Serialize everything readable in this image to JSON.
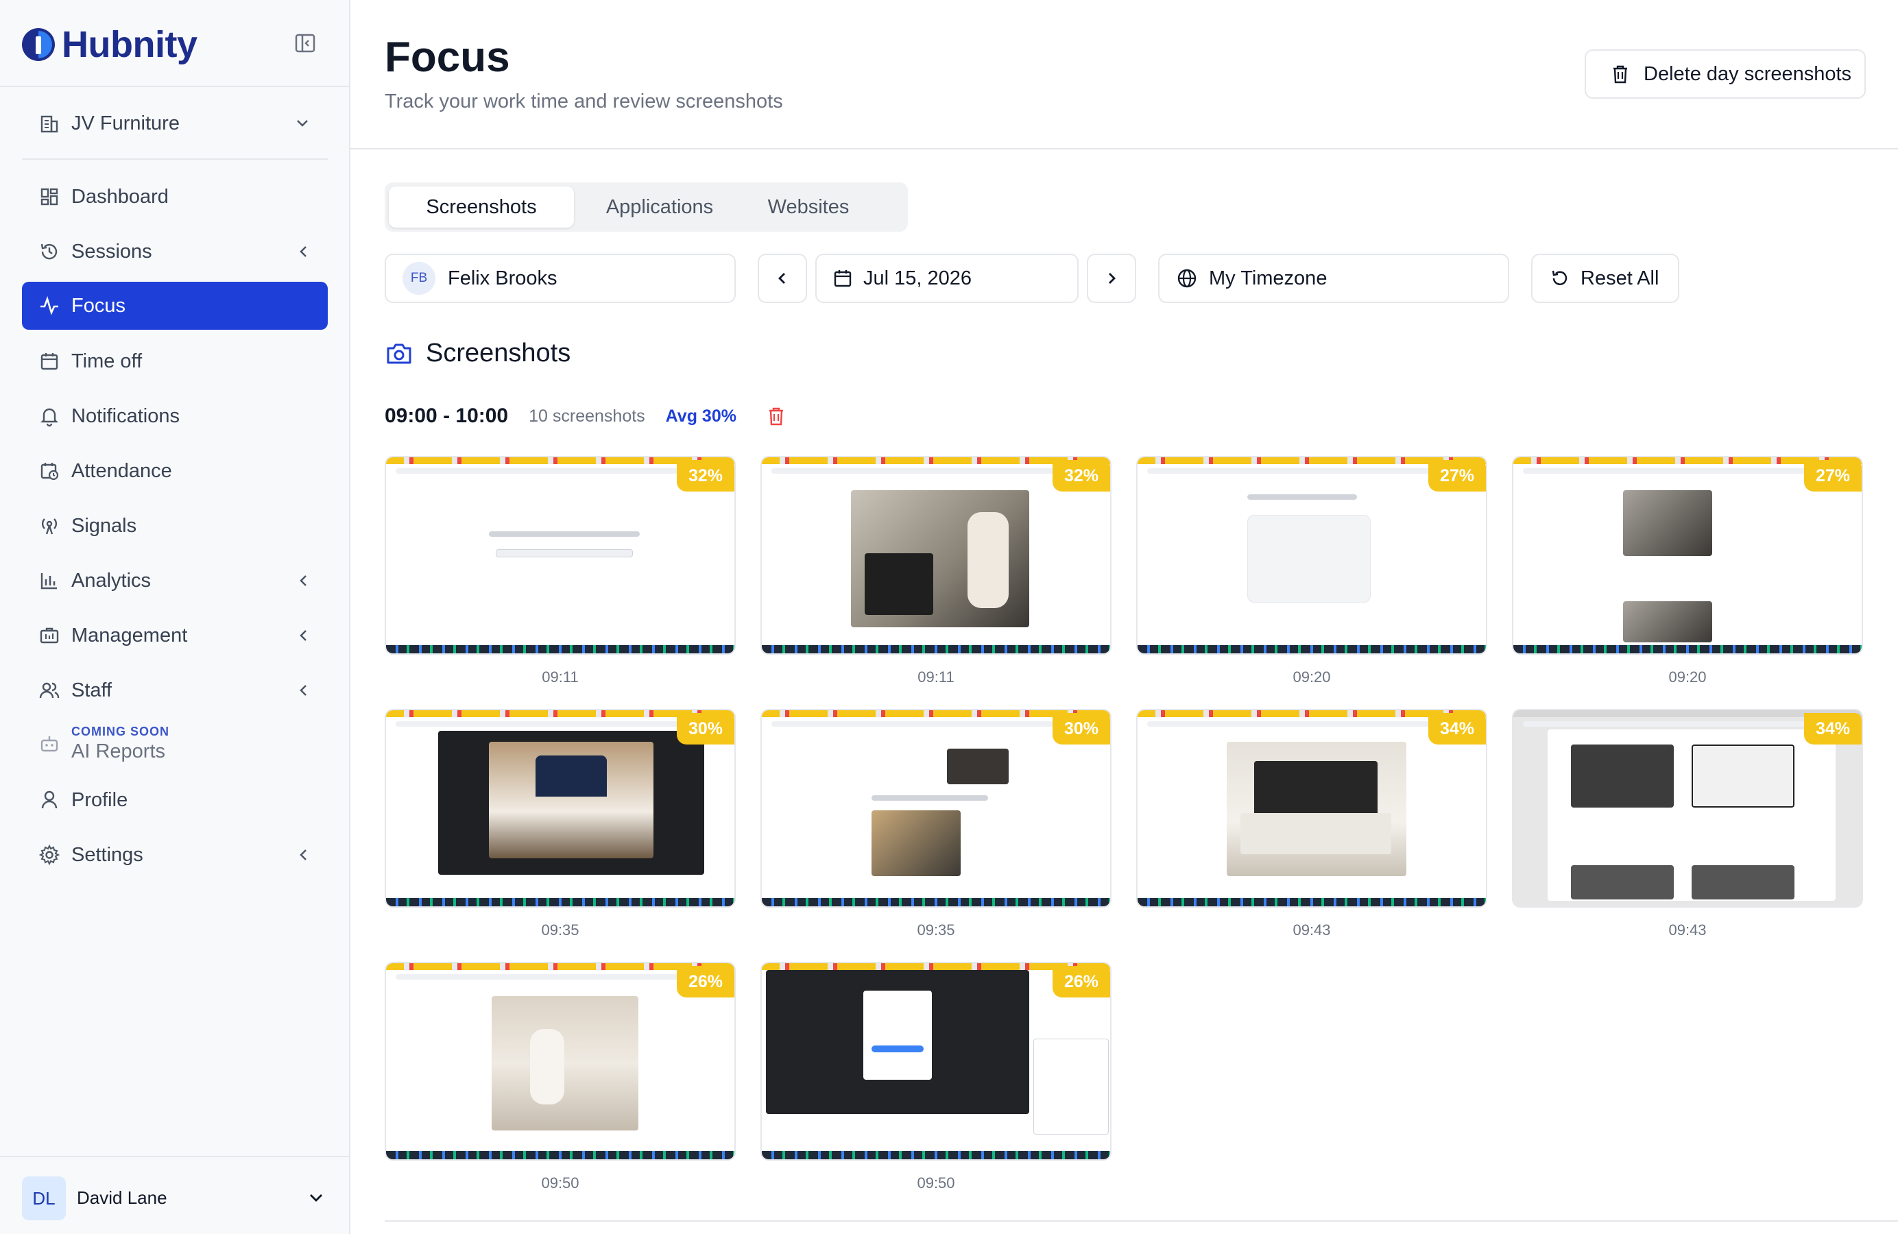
{
  "brand": {
    "name": "Hubnity",
    "primary": "#1f40d8",
    "accent_yellow": "#f5c518",
    "danger": "#ef4444"
  },
  "sidebar": {
    "company": "JV Furniture",
    "items": [
      {
        "label": "Dashboard",
        "icon": "dashboard-icon",
        "expandable": false,
        "active": false
      },
      {
        "label": "Sessions",
        "icon": "history-icon",
        "expandable": true,
        "active": false
      },
      {
        "label": "Focus",
        "icon": "activity-icon",
        "expandable": false,
        "active": true
      },
      {
        "label": "Time off",
        "icon": "calendar-icon",
        "expandable": false,
        "active": false
      },
      {
        "label": "Notifications",
        "icon": "bell-icon",
        "expandable": false,
        "active": false
      },
      {
        "label": "Attendance",
        "icon": "calendar-clock-icon",
        "expandable": false,
        "active": false
      },
      {
        "label": "Signals",
        "icon": "signal-icon",
        "expandable": false,
        "active": false
      },
      {
        "label": "Analytics",
        "icon": "bar-chart-icon",
        "expandable": true,
        "active": false
      },
      {
        "label": "Management",
        "icon": "briefcase-icon",
        "expandable": true,
        "active": false
      },
      {
        "label": "Staff",
        "icon": "users-icon",
        "expandable": true,
        "active": false
      }
    ],
    "coming_soon": {
      "tag": "COMING SOON",
      "label": "AI Reports"
    },
    "bottom_items": [
      {
        "label": "Profile",
        "icon": "user-icon",
        "expandable": false
      },
      {
        "label": "Settings",
        "icon": "gear-icon",
        "expandable": true
      }
    ],
    "user": {
      "initials": "DL",
      "name": "David Lane"
    }
  },
  "header": {
    "title": "Focus",
    "subtitle": "Track your work time and review screenshots",
    "delete_day_label": "Delete day screenshots"
  },
  "tabs": [
    {
      "label": "Screenshots",
      "active": true
    },
    {
      "label": "Applications",
      "active": false
    },
    {
      "label": "Websites",
      "active": false
    }
  ],
  "filters": {
    "employee_initials": "FB",
    "employee_name": "Felix Brooks",
    "date": "Jul 15, 2026",
    "timezone": "My Timezone",
    "reset_label": "Reset All"
  },
  "section": {
    "title": "Screenshots"
  },
  "group": {
    "range": "09:00 - 10:00",
    "count": "10 screenshots",
    "avg": "Avg 30%",
    "shots": [
      {
        "time": "09:11",
        "pct": "32%",
        "content": "agenda-search"
      },
      {
        "time": "09:11",
        "pct": "32%",
        "content": "nightstand-photo"
      },
      {
        "time": "09:20",
        "pct": "27%",
        "content": "blank-grid"
      },
      {
        "time": "09:20",
        "pct": "27%",
        "content": "bed-person-chat"
      },
      {
        "time": "09:35",
        "pct": "30%",
        "content": "blue-bed-dark"
      },
      {
        "time": "09:35",
        "pct": "30%",
        "content": "headboard-chat"
      },
      {
        "time": "09:43",
        "pct": "34%",
        "content": "black-bed"
      },
      {
        "time": "09:43",
        "pct": "34%",
        "content": "headboard-catalog"
      },
      {
        "time": "09:50",
        "pct": "26%",
        "content": "sofa-photo"
      },
      {
        "time": "09:50",
        "pct": "26%",
        "content": "dark-dialog"
      }
    ]
  }
}
